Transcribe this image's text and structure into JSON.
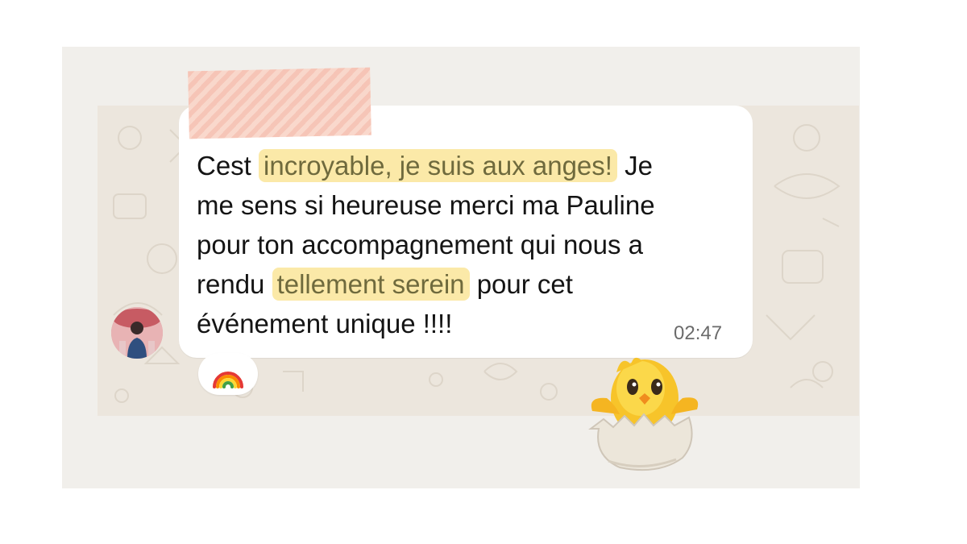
{
  "message": {
    "sender_name": "",
    "lines": [
      {
        "before": "Cest ",
        "highlight": "incroyable, je suis aux anges!",
        "after": " Je"
      },
      {
        "before": "me sens si heureuse merci ma Pauline",
        "highlight": "",
        "after": ""
      },
      {
        "before": "pour ton accompagnement qui nous a",
        "highlight": "",
        "after": ""
      },
      {
        "before": "rendu ",
        "highlight": "tellement serein",
        "after": " pour cet"
      },
      {
        "before": "événement unique !!!!",
        "highlight": "",
        "after": ""
      }
    ],
    "time": "02:47"
  },
  "reaction": {
    "emoji": "🌈",
    "icon": "rainbow-icon"
  },
  "sticker": {
    "icon": "hatching-chick-icon"
  },
  "colors": {
    "highlight": "#fbe9a8",
    "sender": "#2aa86a",
    "chat_background": "#ece6dd"
  }
}
